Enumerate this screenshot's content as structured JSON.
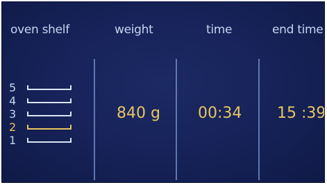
{
  "headers": {
    "oven_shelf": "oven shelf",
    "weight": "weight",
    "time": "time",
    "end_time": "end time"
  },
  "shelves": [
    {
      "number": "5",
      "active": false
    },
    {
      "number": "4",
      "active": false
    },
    {
      "number": "3",
      "active": false
    },
    {
      "number": "2",
      "active": true
    },
    {
      "number": "1",
      "active": false
    }
  ],
  "values": {
    "weight": "840 g",
    "time": "00:34",
    "end_time": "15 :39"
  },
  "colors": {
    "background": "#17235a",
    "text": "#c4d4f0",
    "highlight": "#e7c661",
    "divider": "#6f86c2"
  }
}
